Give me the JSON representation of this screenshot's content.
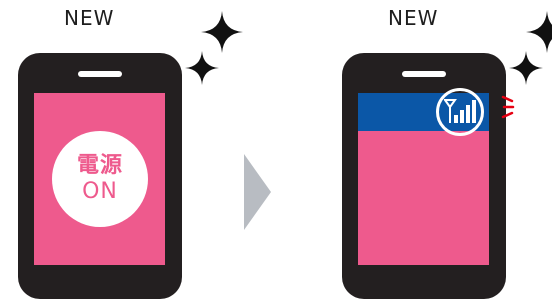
{
  "panels": [
    {
      "label": "NEW",
      "screen_text_line1": "電源",
      "screen_text_line2": "ON"
    },
    {
      "label": "NEW"
    }
  ],
  "colors": {
    "phone_body": "#231f20",
    "screen_pink": "#ee5a8d",
    "status_bar_blue": "#0b57a7",
    "arrow_gray": "#b8bcc2",
    "alert_red": "#e60012"
  },
  "icons": {
    "sparkle": "sparkle-icon",
    "signal": "signal-antenna-icon",
    "arrow": "arrow-right-icon"
  }
}
